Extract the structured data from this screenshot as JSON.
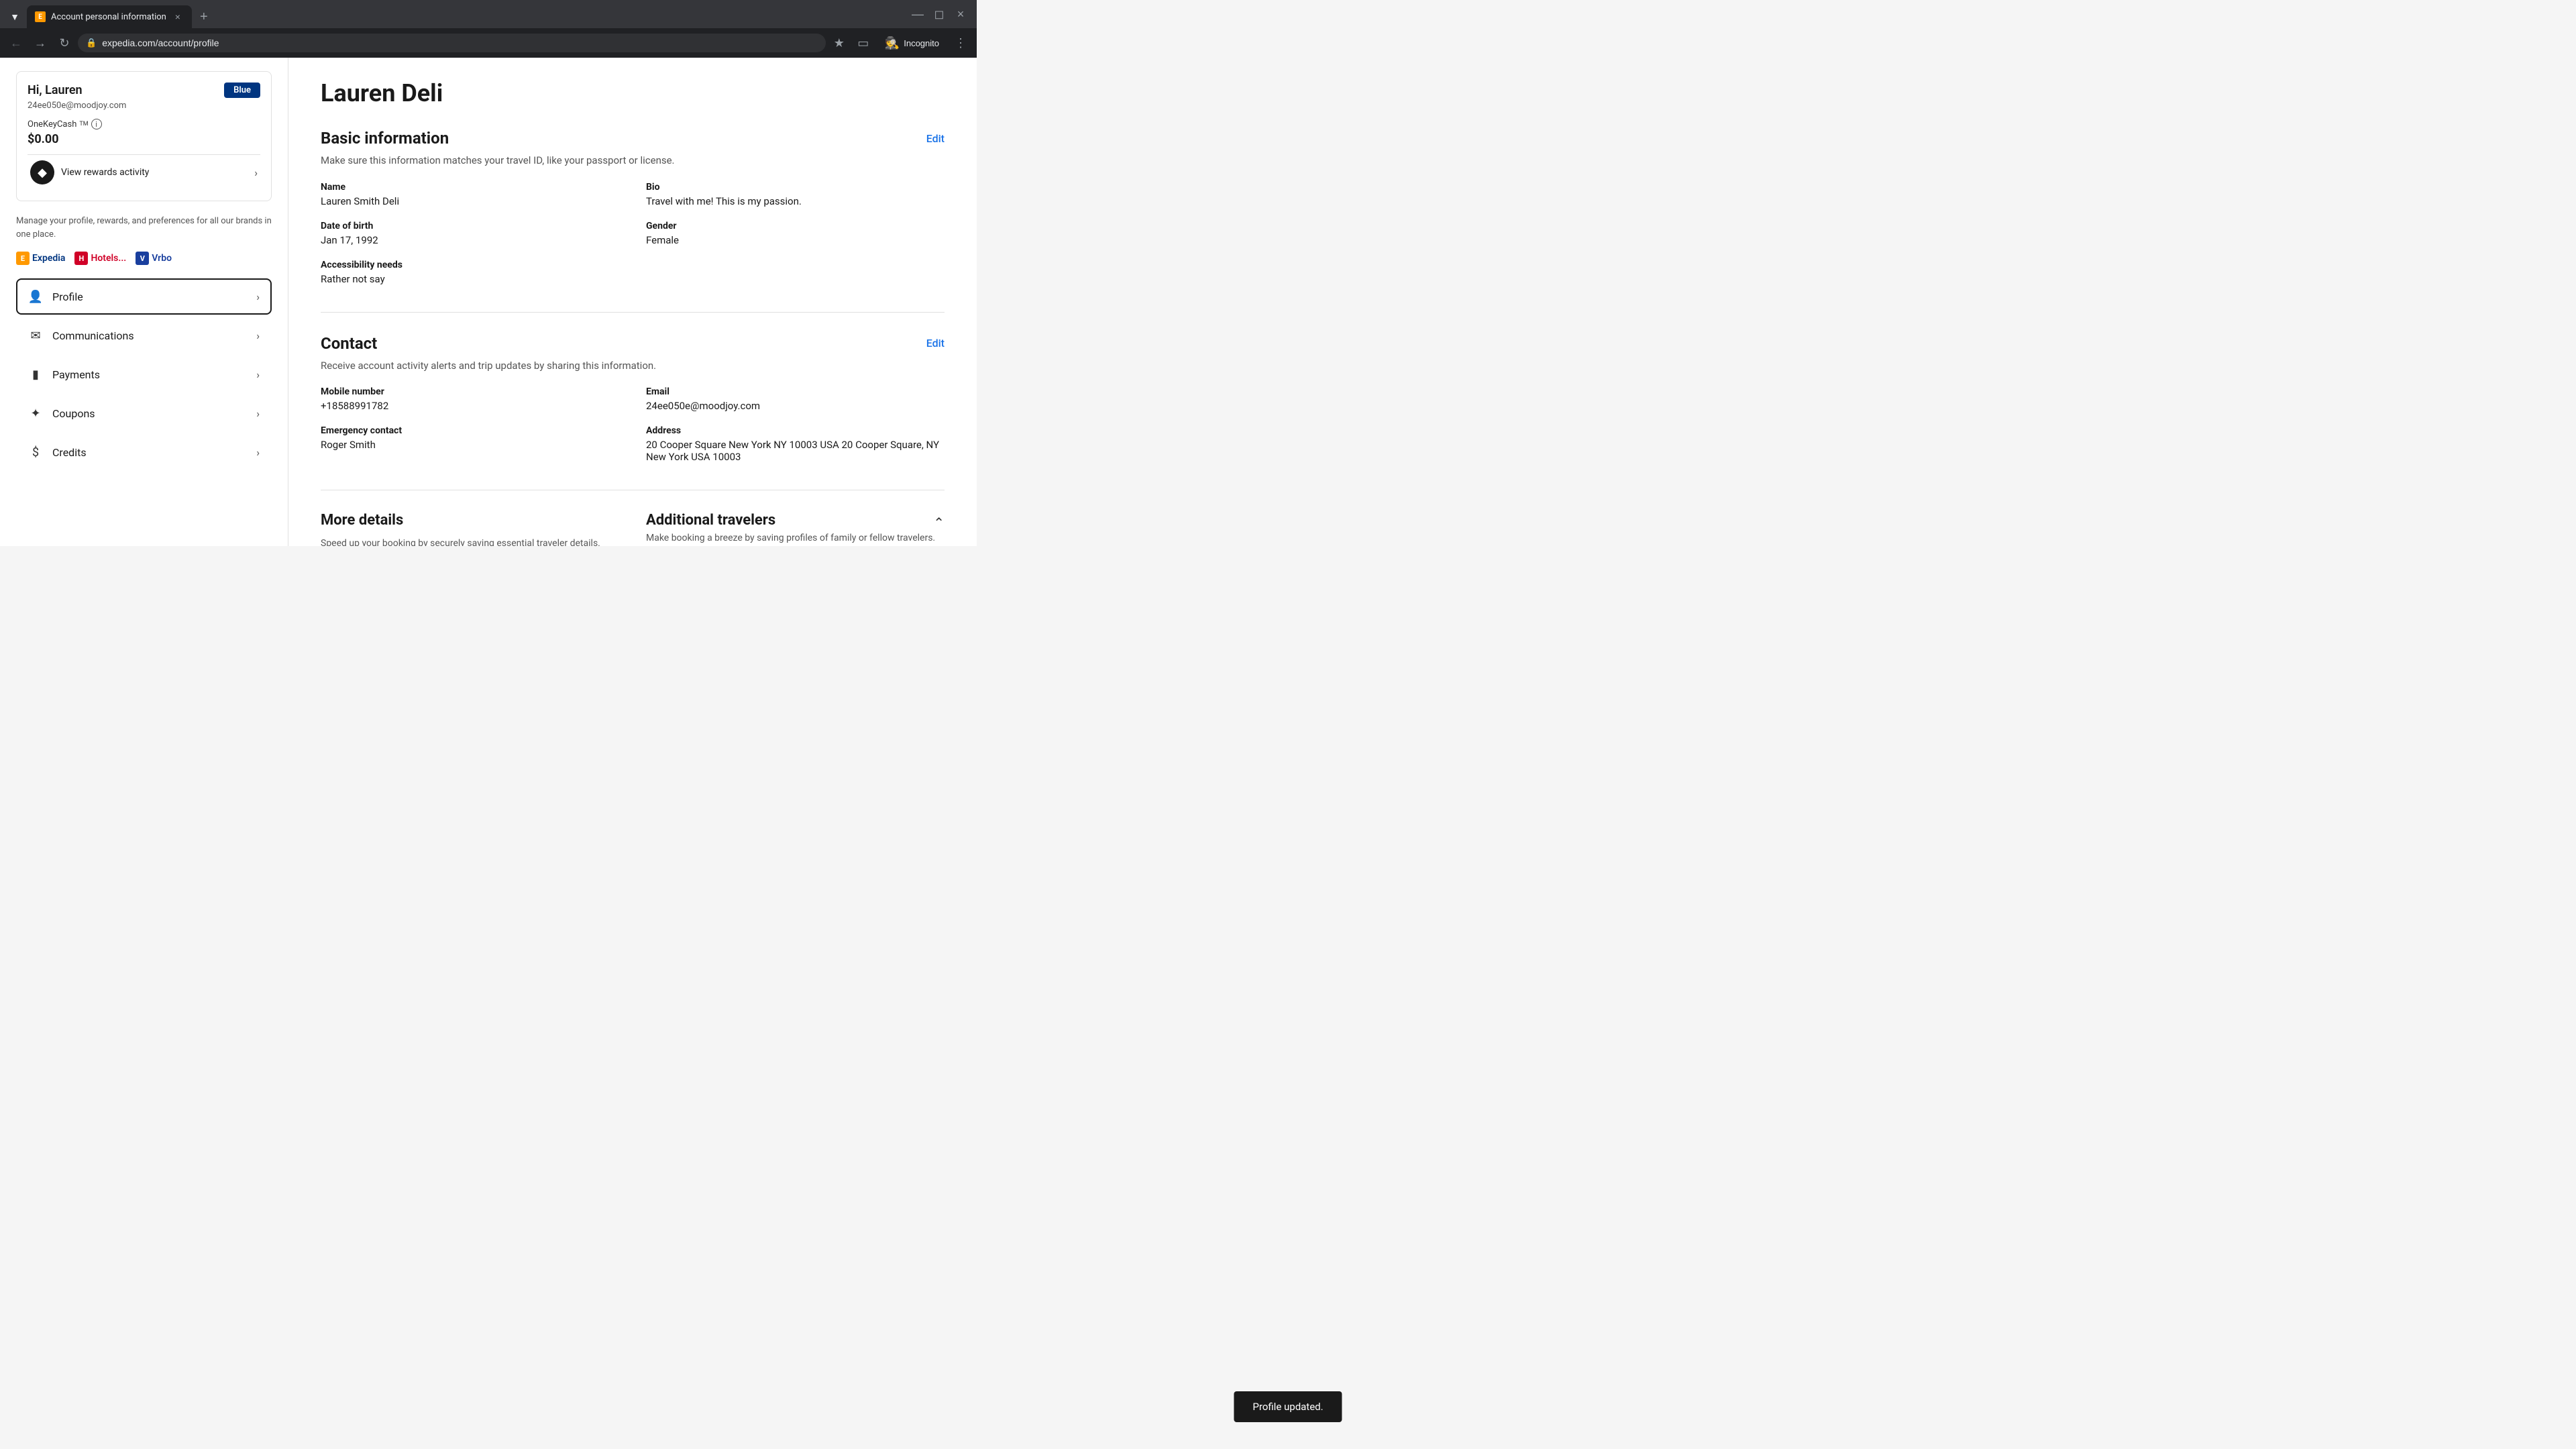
{
  "browser": {
    "tab_title": "Account personal information",
    "favicon_label": "E",
    "url": "expedia.com/account/profile",
    "incognito_label": "Incognito"
  },
  "sidebar": {
    "user_greeting": "Hi, Lauren",
    "user_email": "24ee050e@moodjoy.com",
    "tier_badge": "Blue",
    "onekeycash_label": "OneKeyCash",
    "tm_symbol": "TM",
    "cash_amount": "$0.00",
    "rewards_link_text": "View rewards activity",
    "manage_text": "Manage your profile, rewards, and preferences for all our brands in one place.",
    "brands": [
      {
        "name": "Expedia",
        "icon": "E",
        "type": "expedia"
      },
      {
        "name": "Hotels...",
        "icon": "H",
        "type": "hotels"
      },
      {
        "name": "Vrbo",
        "icon": "V",
        "type": "vrbo"
      }
    ],
    "nav_items": [
      {
        "id": "profile",
        "label": "Profile",
        "icon": "👤",
        "active": true
      },
      {
        "id": "communications",
        "label": "Communications",
        "icon": "✉",
        "active": false
      },
      {
        "id": "payments",
        "label": "Payments",
        "icon": "💳",
        "active": false
      },
      {
        "id": "coupons",
        "label": "Coupons",
        "icon": "🏷",
        "active": false
      },
      {
        "id": "credits",
        "label": "Credits",
        "icon": "💰",
        "active": false
      }
    ]
  },
  "main": {
    "user_display_name": "Lauren Deli",
    "sections": {
      "basic_info": {
        "title": "Basic information",
        "edit_label": "Edit",
        "description": "Make sure this information matches your travel ID, like your passport or license.",
        "fields": [
          {
            "label": "Name",
            "value": "Lauren Smith Deli"
          },
          {
            "label": "Bio",
            "value": "Travel with me! This is my passion."
          },
          {
            "label": "Date of birth",
            "value": "Jan 17, 1992"
          },
          {
            "label": "Gender",
            "value": "Female"
          },
          {
            "label": "Accessibility needs",
            "value": "Rather not say"
          }
        ]
      },
      "contact": {
        "title": "Contact",
        "edit_label": "Edit",
        "description": "Receive account activity alerts and trip updates by sharing this information.",
        "fields": [
          {
            "label": "Mobile number",
            "value": "+18588991782"
          },
          {
            "label": "Email",
            "value": "24ee050e@moodjoy.com"
          },
          {
            "label": "Emergency contact",
            "value": "Roger Smith"
          },
          {
            "label": "Address",
            "value": "20 Cooper Square New York NY 10003 USA 20 Cooper Square, NY New York USA 10003"
          }
        ]
      },
      "more_details": {
        "title": "More details",
        "description": "Speed up your booking by securely saving essential traveler details."
      },
      "additional_travelers": {
        "title": "Additional travelers",
        "description": "Make booking a breeze by saving profiles of family or fellow travelers."
      }
    },
    "toast": {
      "message": "Profile updated."
    }
  }
}
